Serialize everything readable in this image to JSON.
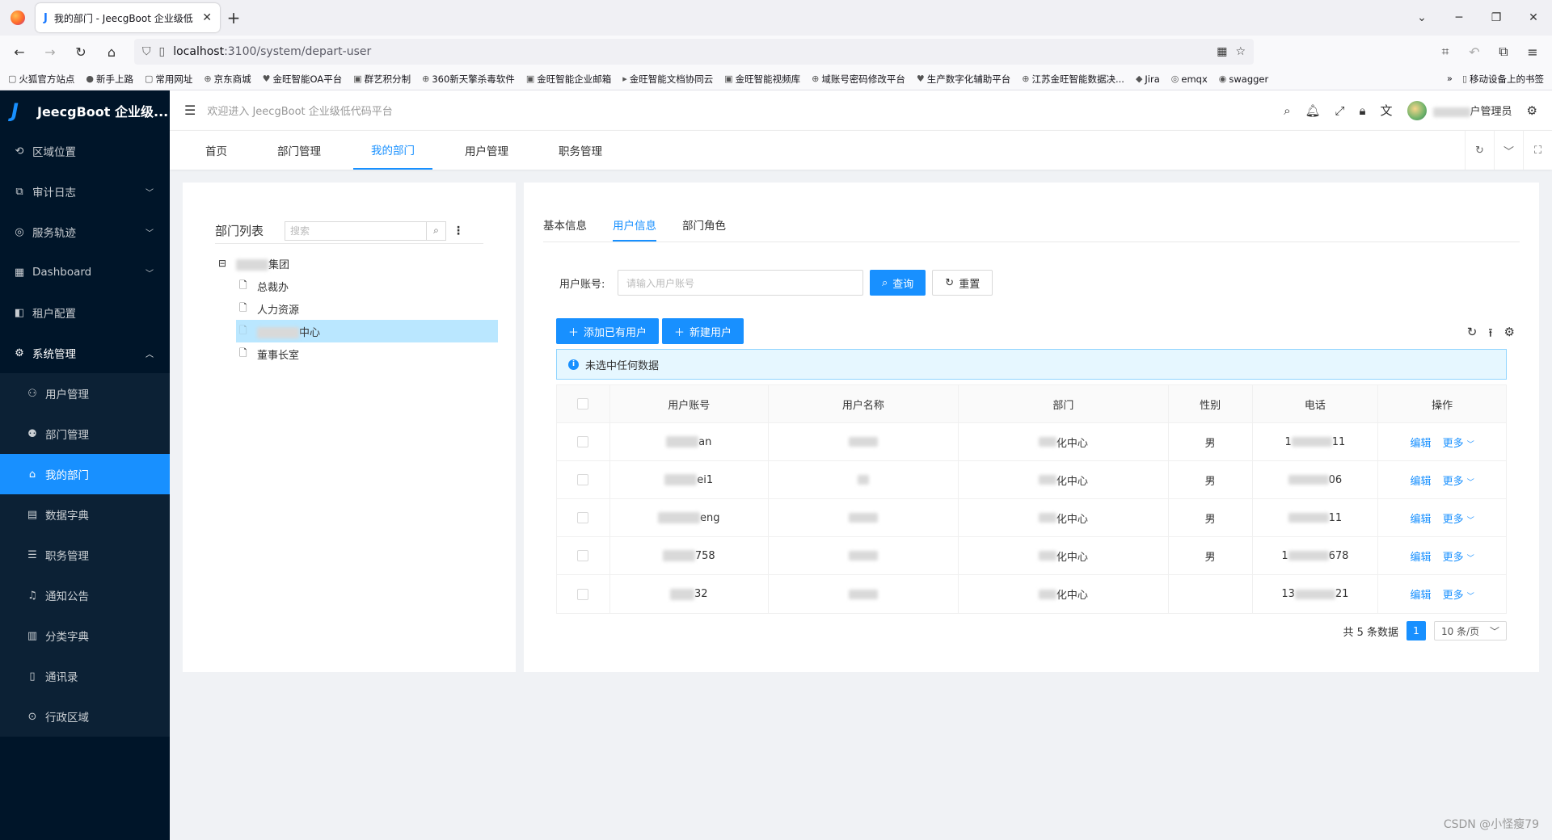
{
  "browser": {
    "tab_title": "我的部门 - JeecgBoot 企业级低",
    "url_host": "localhost",
    "url_path": ":3100/system/depart-user",
    "bookmarks": [
      "火狐官方站点",
      "新手上路",
      "常用网址",
      "京东商城",
      "金旺智能OA平台",
      "群艺积分制",
      "360新天擎杀毒软件",
      "金旺智能企业邮箱",
      "金旺智能文档协同云",
      "金旺智能视频库",
      "域账号密码修改平台",
      "生产数字化辅助平台",
      "江苏金旺智能数据决...",
      "Jira",
      "emqx",
      "swagger"
    ],
    "bookmarks_mobile": "移动设备上的书签"
  },
  "app": {
    "logo_text": "JeecgBoot 企业级...",
    "welcome": "欢迎进入 JeecgBoot 企业级低代码平台",
    "username_suffix": "户管理员"
  },
  "sidebar": {
    "items": [
      {
        "label": "区域位置",
        "icon": "location-icon"
      },
      {
        "label": "审计日志",
        "icon": "audit-icon"
      },
      {
        "label": "服务轨迹",
        "icon": "camera-icon"
      },
      {
        "label": "Dashboard",
        "icon": "dashboard-icon"
      },
      {
        "label": "租户配置",
        "icon": "tenant-icon"
      },
      {
        "label": "系统管理",
        "icon": "gear-icon"
      }
    ],
    "submenu": [
      {
        "label": "用户管理"
      },
      {
        "label": "部门管理"
      },
      {
        "label": "我的部门"
      },
      {
        "label": "数据字典"
      },
      {
        "label": "职务管理"
      },
      {
        "label": "通知公告"
      },
      {
        "label": "分类字典"
      },
      {
        "label": "通讯录"
      },
      {
        "label": "行政区域"
      }
    ]
  },
  "tabs": [
    "首页",
    "部门管理",
    "我的部门",
    "用户管理",
    "职务管理"
  ],
  "left_panel": {
    "title": "部门列表",
    "search_placeholder": "搜索",
    "tree": {
      "root_suffix": "集团",
      "children": [
        "总裁办",
        "人力资源",
        "中心",
        "董事长室"
      ]
    }
  },
  "right_panel": {
    "tabs": [
      "基本信息",
      "用户信息",
      "部门角色"
    ],
    "search_label": "用户账号:",
    "search_placeholder": "请输入用户账号",
    "query_btn": "查询",
    "reset_btn": "重置",
    "add_existing_btn": "添加已有用户",
    "new_user_btn": "新建用户",
    "alert_text": "未选中任何数据",
    "columns": [
      "用户账号",
      "用户名称",
      "部门",
      "性别",
      "电话",
      "操作"
    ],
    "rows": [
      {
        "account": "an",
        "dept": "化中心",
        "gender": "男",
        "phone_a": "1",
        "phone_b": "11"
      },
      {
        "account": "ei1",
        "dept": "化中心",
        "gender": "男",
        "phone_a": "",
        "phone_b": "06"
      },
      {
        "account": "eng",
        "dept": "化中心",
        "gender": "男",
        "phone_a": "",
        "phone_b": "11"
      },
      {
        "account": "758",
        "dept": "化中心",
        "gender": "男",
        "phone_a": "1",
        "phone_b": "678"
      },
      {
        "account": "32",
        "dept": "化中心",
        "gender": "",
        "phone_a": "13",
        "phone_b": "21"
      }
    ],
    "edit_label": "编辑",
    "more_label": "更多",
    "total_text": "共 5 条数据",
    "current_page": "1",
    "page_size": "10 条/页"
  },
  "watermark": "CSDN @小怪瘦79",
  "colors": {
    "primary": "#1890ff",
    "sidebar": "#001529"
  }
}
